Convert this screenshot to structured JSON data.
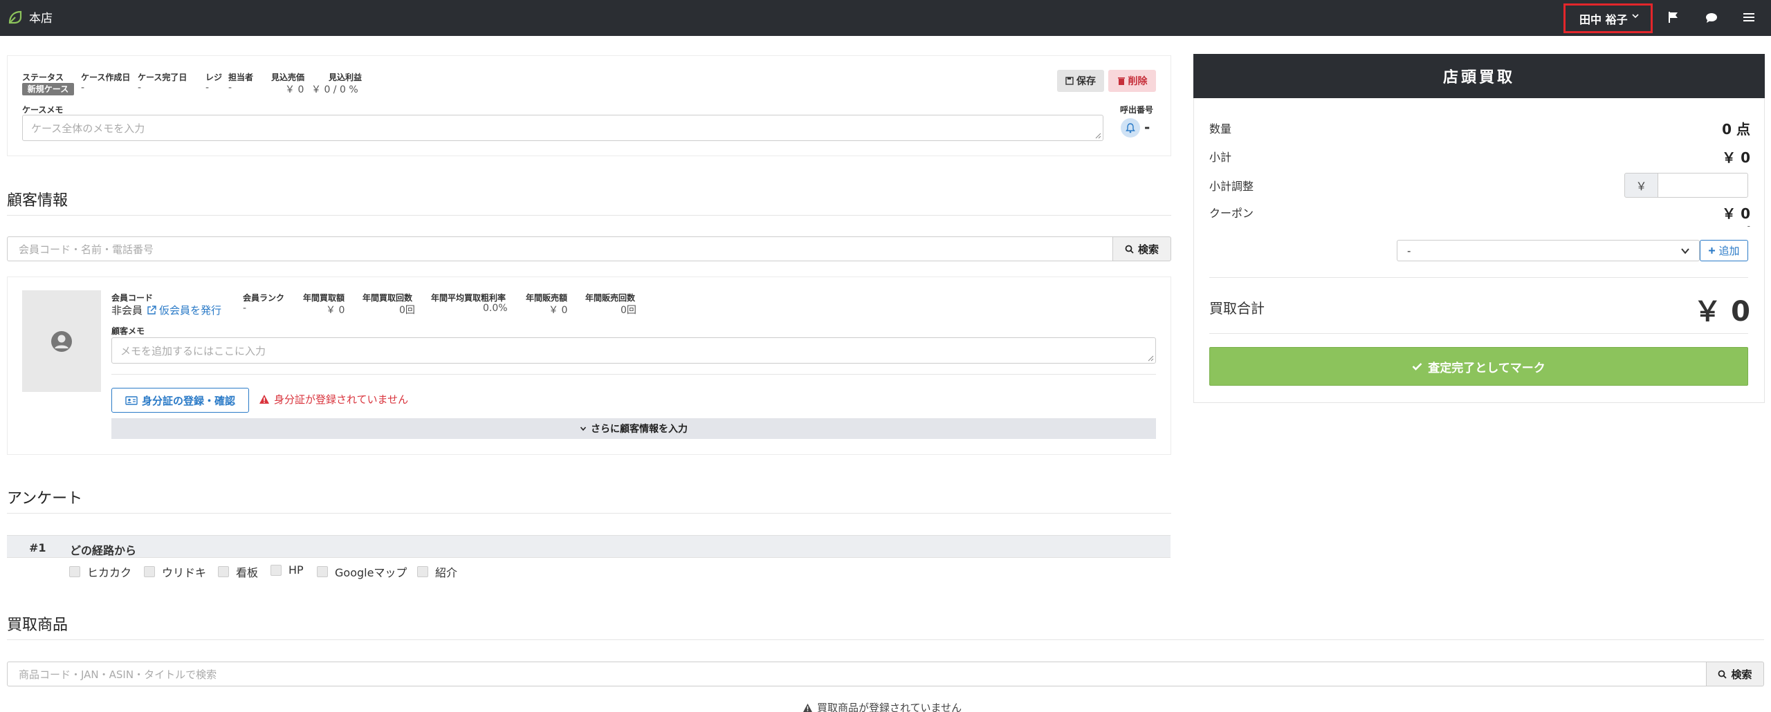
{
  "topbar": {
    "store_name": "本店",
    "user_name": "田中 裕子",
    "icons": [
      "leaf-logo-icon",
      "chevron-down-icon",
      "flag-icon",
      "comment-icon",
      "hamburger-menu-icon"
    ]
  },
  "case": {
    "status_label": "ステータス",
    "status_value": "新規ケース",
    "created_label": "ケース作成日",
    "created_value": "-",
    "completed_label": "ケース完了日",
    "completed_value": "-",
    "register_label": "レジ",
    "register_value": "-",
    "staff_label": "担当者",
    "staff_value": "-",
    "sales_label": "見込売価",
    "sales_value": "￥ 0",
    "profit_label": "見込利益",
    "profit_value": "￥ 0 / 0 %",
    "save_label": "保存",
    "delete_label": "削除",
    "memo_label": "ケースメモ",
    "memo_placeholder": "ケース全体のメモを入力",
    "call_label": "呼出番号",
    "call_value": "-"
  },
  "customer": {
    "section_title": "顧客情報",
    "search_placeholder": "会員コード・名前・電話番号",
    "search_button": "検索",
    "member_code_label": "会員コード",
    "member_code_value": "非会員",
    "issue_temp_link": "仮会員を発行",
    "rank_label": "会員ランク",
    "rank_value": "-",
    "annual_buy_amount_label": "年間買取額",
    "annual_buy_amount_value": "￥ 0",
    "annual_buy_count_label": "年間買取回数",
    "annual_buy_count_value": "0回",
    "avg_margin_label": "年間平均買取粗利率",
    "avg_margin_value": "0.0%",
    "annual_sales_amount_label": "年間販売額",
    "annual_sales_amount_value": "￥ 0",
    "annual_sales_count_label": "年間販売回数",
    "annual_sales_count_value": "0回",
    "memo_label": "顧客メモ",
    "memo_placeholder": "メモを追加するにはここに入力",
    "id_button": "身分証の登録・確認",
    "id_warning": "身分証が登録されていません",
    "more_button": "さらに顧客情報を入力"
  },
  "survey": {
    "section_title": "アンケート",
    "question_number": "#1",
    "question_title": "どの経路から",
    "options": [
      "ヒカカク",
      "ウリドキ",
      "看板",
      "HP",
      "Googleマップ",
      "紹介"
    ]
  },
  "products": {
    "section_title": "買取商品",
    "search_placeholder": "商品コード・JAN・ASIN・タイトルで検索",
    "search_button": "検索",
    "empty_message": "買取商品が登録されていません"
  },
  "summary": {
    "header": "店頭買取",
    "quantity_label": "数量",
    "quantity_value": "0 点",
    "subtotal_label": "小計",
    "subtotal_value": "￥ 0",
    "adjust_label": "小計調整",
    "adjust_prefix": "￥",
    "coupon_label": "クーポン",
    "coupon_value": "￥ 0",
    "coupon_sub": "-",
    "coupon_select_value": "-",
    "add_button": "追加",
    "total_label": "買取合計",
    "total_value": "￥ 0",
    "complete_button": "査定完了としてマーク"
  },
  "colors": {
    "topbar": "#2b2e33",
    "highlight": "#e3262b",
    "accent_blue": "#2a7ac7",
    "danger": "#d9343d",
    "success": "#8cc35c"
  }
}
